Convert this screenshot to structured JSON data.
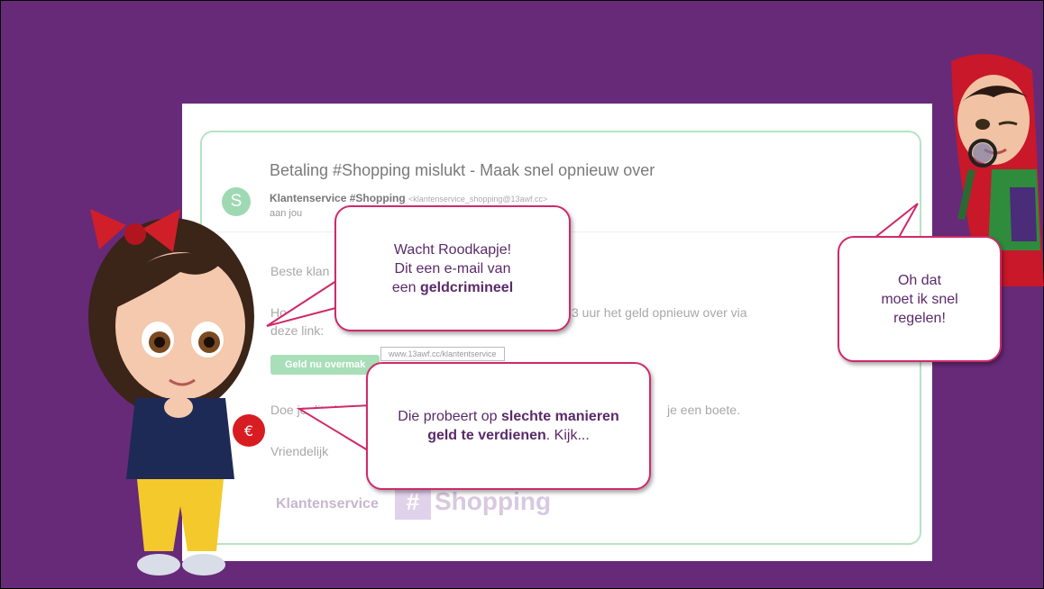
{
  "email": {
    "subject": "Betaling #Shopping mislukt - Maak snel opnieuw over",
    "avatar_letter": "S",
    "sender_name": "Klantenservice #Shopping",
    "sender_address": "<klantenservice_shopping@13awf.cc>",
    "to": "aan jou",
    "greeting": "Beste klan",
    "line1_left": "Ho",
    "line1_right": "3 uur het geld opnieuw over via",
    "line2": "deze link:",
    "button_label": "Geld nu overmak",
    "link_tooltip": "www.13awf.cc/klantentservice",
    "line3_left": "Doe je dit niet?",
    "line3_right": "je een boete.",
    "closing": "Vriendelijk",
    "signature_label": "Klantenservice",
    "signature_hash": "#",
    "signature_logo": "Shopping"
  },
  "bubbles": {
    "warning": {
      "line1": "Wacht Roodkapje!",
      "line2": "Dit een e-mail van",
      "line3_prefix": "een ",
      "line3_bold": "geldcrimineel"
    },
    "explain": {
      "bold1": "Die probeert op ",
      "bold_part": "slechte manieren geld te verdienen",
      "suffix": ". Kijk..."
    },
    "reply": {
      "line1": "Oh dat",
      "line2": "moet ik snel",
      "line3": "regelen!"
    }
  },
  "colors": {
    "background": "#672a78",
    "accent": "#cf2a6a",
    "email_border": "#b7e3c2"
  }
}
